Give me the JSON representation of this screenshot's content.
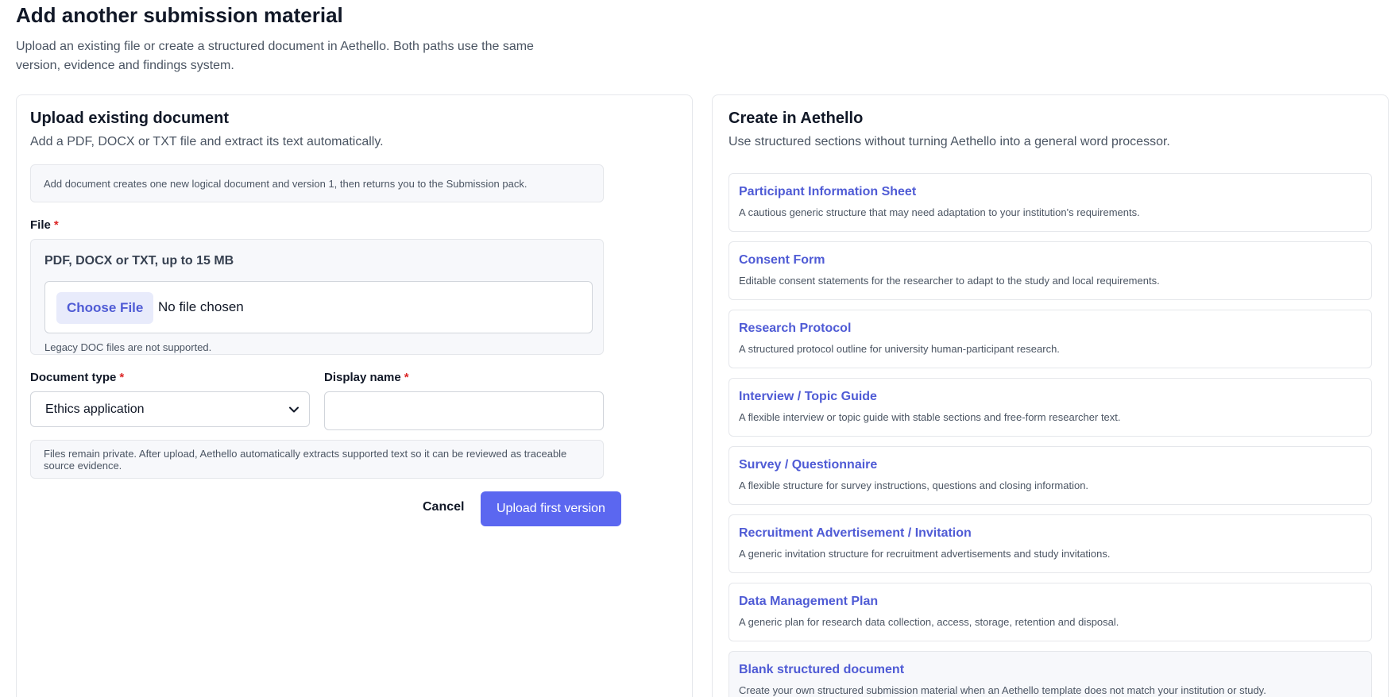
{
  "page": {
    "title": "Add another submission material",
    "subtitle": "Upload an existing file or create a structured document in Aethello. Both paths use the same version, evidence and findings system."
  },
  "upload": {
    "title": "Upload existing document",
    "subtitle": "Add a PDF, DOCX or TXT file and extract its text automatically.",
    "info": "Add document creates one new logical document and version 1, then returns you to the Submission pack.",
    "file_label": "File",
    "required_mark": "*",
    "file_hint": "PDF, DOCX or TXT, up to 15 MB",
    "choose_file_label": "Choose File",
    "no_file_text": "No file chosen",
    "legacy_note": "Legacy DOC files are not supported.",
    "doc_type_label": "Document type",
    "doc_type_value": "Ethics application",
    "display_name_label": "Display name",
    "display_name_value": "",
    "privacy_note": "Files remain private. After upload, Aethello automatically extracts supported text so it can be reviewed as traceable source evidence.",
    "cancel_label": "Cancel",
    "submit_label": "Upload first version"
  },
  "create": {
    "title": "Create in Aethello",
    "subtitle": "Use structured sections without turning Aethello into a general word processor.",
    "templates": [
      {
        "name": "Participant Information Sheet",
        "description": "A cautious generic structure that may need adaptation to your institution's requirements."
      },
      {
        "name": "Consent Form",
        "description": "Editable consent statements for the researcher to adapt to the study and local requirements."
      },
      {
        "name": "Research Protocol",
        "description": "A structured protocol outline for university human-participant research."
      },
      {
        "name": "Interview / Topic Guide",
        "description": "A flexible interview or topic guide with stable sections and free-form researcher text."
      },
      {
        "name": "Survey / Questionnaire",
        "description": "A flexible structure for survey instructions, questions and closing information."
      },
      {
        "name": "Recruitment Advertisement / Invitation",
        "description": "A generic invitation structure for recruitment advertisements and study invitations."
      },
      {
        "name": "Data Management Plan",
        "description": "A generic plan for research data collection, access, storage, retention and disposal."
      },
      {
        "name": "Blank structured document",
        "description": "Create your own structured submission material when an Aethello template does not match your institution or study."
      }
    ]
  },
  "colors": {
    "accent": "#5b67f0",
    "link": "#4f5bd5",
    "required": "#dc2626"
  }
}
